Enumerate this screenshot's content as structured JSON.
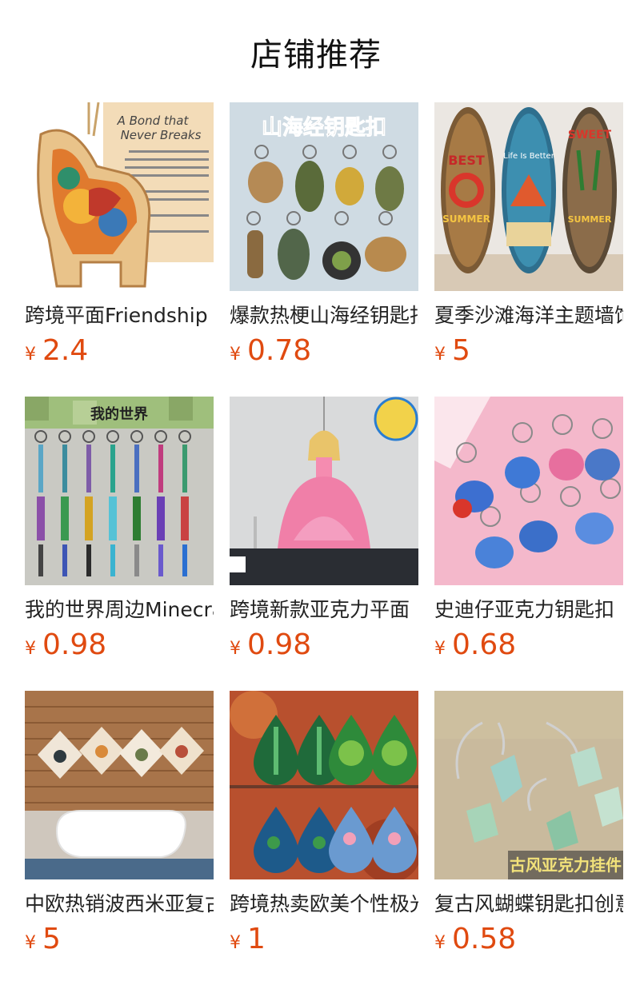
{
  "page_title": "店铺推荐",
  "currency_symbol": "¥",
  "products": [
    {
      "name": "跨境平面Friendship",
      "price": "2.4",
      "overlay": "A Bond that Never Breaks"
    },
    {
      "name": "爆款热梗山海经钥匙扣",
      "price": "0.78",
      "overlay": "山海经钥匙扣"
    },
    {
      "name": "夏季沙滩海洋主题墙饰",
      "price": "5",
      "overlay": ""
    },
    {
      "name": "我的世界周边Minecraft",
      "price": "0.98",
      "overlay": "我的世界"
    },
    {
      "name": "跨境新款亚克力平面",
      "price": "0.98",
      "overlay": ""
    },
    {
      "name": "史迪仔亚克力钥匙扣",
      "price": "0.68",
      "overlay": ""
    },
    {
      "name": "中欧热销波西米亚复古",
      "price": "5",
      "overlay": ""
    },
    {
      "name": "跨境热卖欧美个性极光",
      "price": "1",
      "overlay": ""
    },
    {
      "name": "复古风蝴蝶钥匙扣创意",
      "price": "0.58",
      "overlay": "古风亚克力挂件"
    }
  ]
}
